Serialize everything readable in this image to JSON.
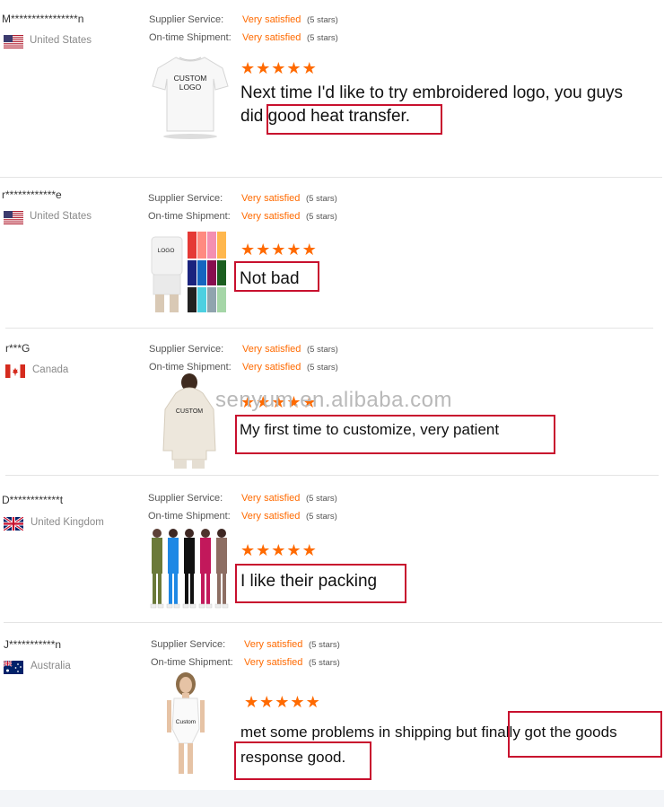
{
  "labels": {
    "supplier_service": "Supplier Service:",
    "on_time_shipment": "On-time Shipment:"
  },
  "reviews": [
    {
      "user": "M****************n",
      "country": "United States",
      "flag": "us",
      "supplier_service": "Very satisfied",
      "supplier_stars": "(5 stars)",
      "shipment": "Very satisfied",
      "shipment_stars": "(5 stars)",
      "rating": 5,
      "comment_line1": "Next time I'd like to try embroidered logo, you guys",
      "comment_line2": "did good heat transfer.",
      "image_text": "CUSTOM\nLOGO"
    },
    {
      "user": "r************e",
      "country": "United States",
      "flag": "us",
      "supplier_service": "Very satisfied",
      "supplier_stars": "(5 stars)",
      "shipment": "Very satisfied",
      "shipment_stars": "(5 stars)",
      "rating": 5,
      "comment_line1": "Not bad",
      "image_text": "LOGO"
    },
    {
      "user": "r***G",
      "country": "Canada",
      "flag": "ca",
      "supplier_service": "Very satisfied",
      "supplier_stars": "(5 stars)",
      "shipment": "Very satisfied",
      "shipment_stars": "(5 stars)",
      "rating": 5,
      "comment_line1": "My first time to customize, very patient",
      "image_text": "CUSTOM"
    },
    {
      "user": "D************t",
      "country": "United Kingdom",
      "flag": "uk",
      "supplier_service": "Very satisfied",
      "supplier_stars": "(5 stars)",
      "shipment": "Very satisfied",
      "shipment_stars": "(5 stars)",
      "rating": 5,
      "comment_line1": "I like their packing"
    },
    {
      "user": "J***********n",
      "country": "Australia",
      "flag": "au",
      "supplier_service": "Very satisfied",
      "supplier_stars": "(5 stars)",
      "shipment": "Very satisfied",
      "shipment_stars": "(5 stars)",
      "rating": 5,
      "comment_line1": "met some problems in shipping but finally got the goods",
      "comment_line2": "response good.",
      "image_text": "Custom"
    }
  ],
  "watermark": "senyum.en.alibaba.com",
  "colors": {
    "accent": "#ff6a00",
    "highlight": "#c8102e",
    "divider": "#e4e4e4"
  }
}
